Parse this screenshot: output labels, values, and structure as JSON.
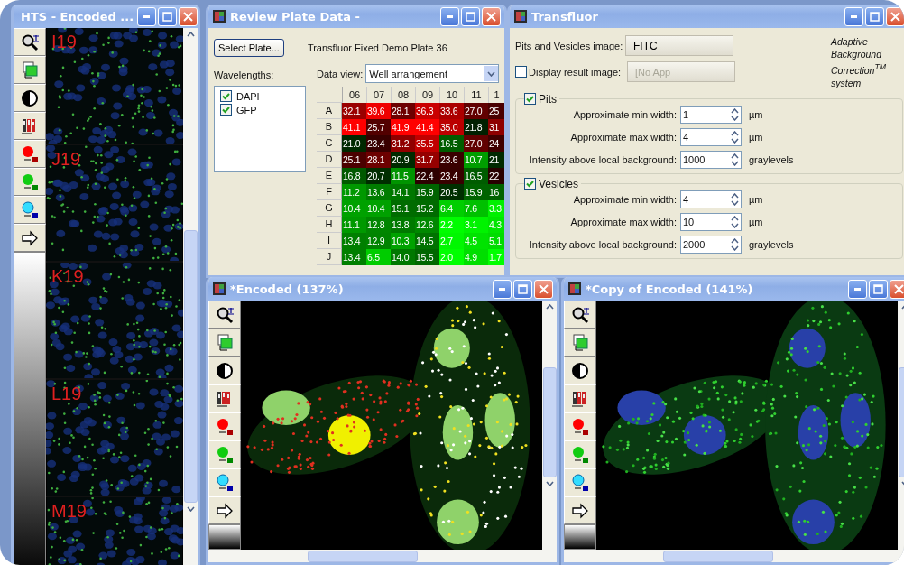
{
  "hts_window": {
    "title": "HTS - Encoded ...",
    "tiles": [
      {
        "label": "I19"
      },
      {
        "label": "J19"
      },
      {
        "label": "K19"
      },
      {
        "label": "L19"
      },
      {
        "label": "M19"
      }
    ]
  },
  "review_window": {
    "title": "Review Plate Data -",
    "select_button": "Select Plate...",
    "plate_name": "Transfluor Fixed Demo Plate 36",
    "wavelengths_label": "Wavelengths:",
    "wavelengths": [
      {
        "label": "DAPI",
        "checked": true
      },
      {
        "label": "GFP",
        "checked": true
      }
    ],
    "data_view_label": "Data view:",
    "data_view": "Well arrangement",
    "grid": {
      "columns": [
        "06",
        "07",
        "08",
        "09",
        "10",
        "11",
        "1"
      ],
      "rows": [
        {
          "label": "A",
          "cells": [
            "32.1",
            "39.6",
            "28.1",
            "36.3",
            "33.6",
            "27.0",
            "25"
          ]
        },
        {
          "label": "B",
          "cells": [
            "41.1",
            "25.7",
            "41.9",
            "41.4",
            "35.0",
            "21.8",
            "31"
          ]
        },
        {
          "label": "C",
          "cells": [
            "21.0",
            "23.4",
            "31.2",
            "35.5",
            "16.5",
            "27.0",
            "24"
          ]
        },
        {
          "label": "D",
          "cells": [
            "25.1",
            "28.1",
            "20.9",
            "31.7",
            "23.6",
            "10.7",
            "21"
          ]
        },
        {
          "label": "E",
          "cells": [
            "16.8",
            "20.7",
            "11.5",
            "22.4",
            "23.4",
            "16.5",
            "22"
          ]
        },
        {
          "label": "F",
          "cells": [
            "11.2",
            "13.6",
            "14.1",
            "15.9",
            "20.5",
            "15.9",
            "16"
          ]
        },
        {
          "label": "G",
          "cells": [
            "10.4",
            "10.4",
            "15.1",
            "15.2",
            "6.4",
            "7.6",
            "3.3"
          ]
        },
        {
          "label": "H",
          "cells": [
            "11.1",
            "12.8",
            "13.8",
            "12.6",
            "2.2",
            "3.1",
            "4.3"
          ]
        },
        {
          "label": "I",
          "cells": [
            "13.4",
            "12.9",
            "10.3",
            "14.5",
            "2.7",
            "4.5",
            "5.1"
          ]
        },
        {
          "label": "J",
          "cells": [
            "13.4",
            "6.5",
            "14.0",
            "15.5",
            "2.0",
            "4.9",
            "1.7"
          ]
        }
      ]
    }
  },
  "transfluor_window": {
    "title": "Transfluor",
    "image_label": "Pits and Vesicles image:",
    "image_button": "FITC",
    "display_result": {
      "label": "Display result image:",
      "checked": false
    },
    "result_button": {
      "label": "[No App",
      "disabled": true
    },
    "note": "Adaptive Background Correction$^{TM}$ system",
    "groups": [
      {
        "label": "Pits",
        "checked": true,
        "fields": [
          {
            "label": "Approximate min width:",
            "value": "1",
            "unit": "µm"
          },
          {
            "label": "Approximate max width:",
            "value": "4",
            "unit": "µm"
          },
          {
            "label": "Intensity above local background:",
            "value": "1000",
            "unit": "graylevels"
          }
        ]
      },
      {
        "label": "Vesicles",
        "checked": true,
        "fields": [
          {
            "label": "Approximate min width:",
            "value": "4",
            "unit": "µm"
          },
          {
            "label": "Approximate max width:",
            "value": "10",
            "unit": "µm"
          },
          {
            "label": "Intensity above local background:",
            "value": "2000",
            "unit": "graylevels"
          }
        ]
      }
    ]
  },
  "image_windows": [
    {
      "title": "*Encoded (137%)",
      "kind": "overlay"
    },
    {
      "title": "*Copy of Encoded (141%)",
      "kind": "raw"
    }
  ]
}
